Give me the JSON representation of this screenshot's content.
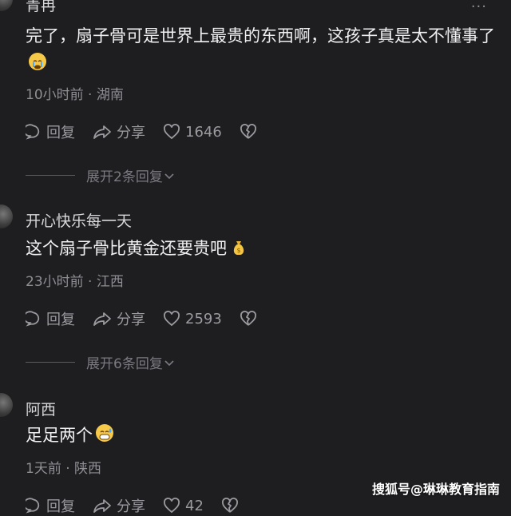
{
  "comments": [
    {
      "username": "青冉",
      "text": "完了，扇子骨可是世界上最贵的东西啊，这孩子真是太不懂事了",
      "emoji": "crying-face",
      "time": "10小时前 · 湖南",
      "reply_label": "回复",
      "share_label": "分享",
      "likes": "1646",
      "expand_label": "展开2条回复"
    },
    {
      "username": "开心快乐每一天",
      "text": "这个扇子骨比黄金还要贵吧",
      "emoji": "money-bag",
      "time": "23小时前 · 江西",
      "reply_label": "回复",
      "share_label": "分享",
      "likes": "2593",
      "expand_label": "展开6条回复"
    },
    {
      "username": "阿西",
      "text": "足足两个",
      "emoji": "grinning-sweat-face",
      "time": "1天前 · 陕西",
      "reply_label": "回复",
      "share_label": "分享",
      "likes": "42"
    }
  ],
  "more_label": "···",
  "watermark": "搜狐号@琳琳教育指南"
}
